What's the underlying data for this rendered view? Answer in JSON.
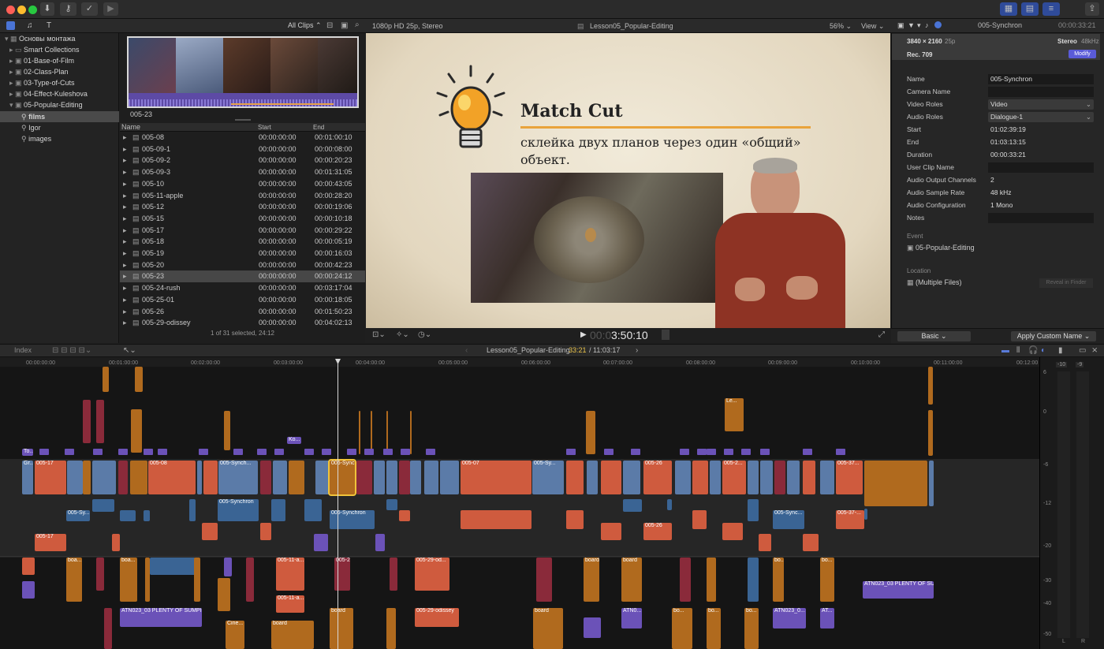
{
  "titlebar": {
    "icons": [
      "import-icon",
      "key-icon",
      "check-icon",
      "share-icon"
    ]
  },
  "browser_header": {
    "filter": "All Clips"
  },
  "libraries": {
    "items": [
      {
        "label": "Основы монтажа"
      },
      {
        "label": "Smart Collections"
      },
      {
        "label": "01-Base-of-Film"
      },
      {
        "label": "02-Class-Plan"
      },
      {
        "label": "03-Type-of-Cuts"
      },
      {
        "label": "04-Effect-Kuleshova"
      },
      {
        "label": "05-Popular-Editing"
      },
      {
        "label": "films"
      },
      {
        "label": "Igor"
      },
      {
        "label": "images"
      }
    ]
  },
  "filmstrip": {
    "label": "005-23"
  },
  "list": {
    "headers": {
      "name": "Name",
      "start": "Start",
      "end": "End"
    },
    "rows": [
      {
        "name": "005-08",
        "start": "00:00:00:00",
        "end": "00:01:00:10"
      },
      {
        "name": "005-09-1",
        "start": "00:00:00:00",
        "end": "00:00:08:00"
      },
      {
        "name": "005-09-2",
        "start": "00:00:00:00",
        "end": "00:00:20:23"
      },
      {
        "name": "005-09-3",
        "start": "00:00:00:00",
        "end": "00:01:31:05"
      },
      {
        "name": "005-10",
        "start": "00:00:00:00",
        "end": "00:00:43:05"
      },
      {
        "name": "005-11-apple",
        "start": "00:00:00:00",
        "end": "00:00:28:20"
      },
      {
        "name": "005-12",
        "start": "00:00:00:00",
        "end": "00:00:19:06"
      },
      {
        "name": "005-15",
        "start": "00:00:00:00",
        "end": "00:00:10:18"
      },
      {
        "name": "005-17",
        "start": "00:00:00:00",
        "end": "00:00:29:22"
      },
      {
        "name": "005-18",
        "start": "00:00:00:00",
        "end": "00:00:05:19"
      },
      {
        "name": "005-19",
        "start": "00:00:00:00",
        "end": "00:00:16:03"
      },
      {
        "name": "005-20",
        "start": "00:00:00:00",
        "end": "00:00:42:23"
      },
      {
        "name": "005-23",
        "start": "00:00:00:00",
        "end": "00:00:24:12"
      },
      {
        "name": "005-24-rush",
        "start": "00:00:00:00",
        "end": "00:03:17:04"
      },
      {
        "name": "005-25-01",
        "start": "00:00:00:00",
        "end": "00:00:18:05"
      },
      {
        "name": "005-26",
        "start": "00:00:00:00",
        "end": "00:01:50:23"
      },
      {
        "name": "005-29-odissey",
        "start": "00:00:00:00",
        "end": "00:04:02:13"
      }
    ],
    "status": "1 of 31 selected, 24:12"
  },
  "viewer": {
    "format": "1080p HD 25p, Stereo",
    "project": "Lesson05_Popular-Editing",
    "zoom": "56%",
    "view_menu": "View",
    "slide_title": "Match Cut",
    "slide_subtitle": "склейка двух планов через один «общий» объект.",
    "timecode_dim": "00:0",
    "timecode": "3:50:10"
  },
  "inspector": {
    "duration_top": "00:00:33:21",
    "clip_name_top": "005-Synchron",
    "resolution": "3840 × 2160",
    "fps": "25p",
    "audio_format": "Stereo",
    "sample": "48kHz",
    "rec": "Rec. 709",
    "modify": "Modify",
    "fields": [
      {
        "label": "Name",
        "value": "005-Synchron"
      },
      {
        "label": "Camera Name",
        "value": ""
      },
      {
        "label": "Video Roles",
        "value": "Video"
      },
      {
        "label": "Audio Roles",
        "value": "Dialogue-1"
      },
      {
        "label": "Start",
        "value": "01:02:39:19"
      },
      {
        "label": "End",
        "value": "01:03:13:15"
      },
      {
        "label": "Duration",
        "value": "00:00:33:21"
      },
      {
        "label": "User Clip Name",
        "value": ""
      },
      {
        "label": "Audio Output Channels",
        "value": "2"
      },
      {
        "label": "Audio Sample Rate",
        "value": "48 kHz"
      },
      {
        "label": "Audio Configuration",
        "value": "1 Mono"
      },
      {
        "label": "Notes",
        "value": ""
      }
    ],
    "event_label": "Event",
    "event_value": "05-Popular-Editing",
    "location_label": "Location",
    "location_value": "(Multiple Files)",
    "reveal": "Reveal in Finder",
    "metadata_view": "Basic",
    "apply_button": "Apply Custom Name"
  },
  "timeline_bar": {
    "index": "Index",
    "project": "Lesson05_Popular-Editing",
    "position": "33:21",
    "total": "/ 11:03:17"
  },
  "ruler": [
    "00:00:00:00",
    "00:01:00:00",
    "00:02:00:00",
    "00:03:00:00",
    "00:04:00:00",
    "00:05:00:00",
    "00:06:00:00",
    "00:07:00:00",
    "00:08:00:00",
    "00:09:00:00",
    "00:10:00:00",
    "00:11:00:00",
    "00:12:00"
  ],
  "meters": {
    "scale": [
      "6",
      "0",
      "-6",
      "-12",
      "-20",
      "-30",
      "-40",
      "-50"
    ],
    "top": [
      "-10",
      "-9"
    ],
    "channels": [
      "L",
      "R"
    ]
  },
  "clips": {
    "primary": [
      "Gr...",
      "005-17",
      "005-08",
      "005-Synch...",
      "005-Synchron",
      "005-07",
      "005-Sy...",
      "005-26",
      "005-2...",
      "005-37..."
    ],
    "audio": [
      "005-...",
      "005-Sy...",
      "005-Synchron",
      "005-Synchron",
      "005-Sync...",
      "005-26",
      "005-37-...",
      "005-17",
      "005-07",
      "005-2...",
      "005-..."
    ],
    "lower": [
      "boa...",
      "boa...",
      "005-11-a...",
      "005-29-od...",
      "board",
      "board",
      "ATN023_03 PLENTY OF SUMPIN",
      "005-11-a...",
      "005-29-odissey",
      "board",
      "ATN0...",
      "ATN023_0...",
      "ATN023_03 PLENTY OF SU...",
      "Cine...",
      "board",
      "bo...",
      "AT..."
    ],
    "upper": [
      "To...",
      "Ko...",
      "Le...",
      "005-Sync"
    ]
  }
}
